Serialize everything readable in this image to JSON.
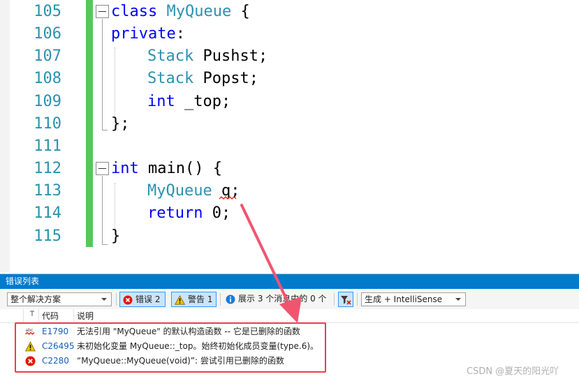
{
  "editor": {
    "line_numbers": [
      "105",
      "106",
      "107",
      "108",
      "109",
      "110",
      "111",
      "112",
      "113",
      "114",
      "115"
    ],
    "lines": {
      "l105": {
        "kw": "class",
        "name": "MyQueue",
        "brace": "{"
      },
      "l106": {
        "kw": "private",
        "colon": ":"
      },
      "l107": {
        "type": "Stack",
        "rest": "Pushst;"
      },
      "l108": {
        "type": "Stack",
        "rest": "Popst;"
      },
      "l109": {
        "kw": "int",
        "rest": "_top;"
      },
      "l110": {
        "text": "};"
      },
      "l112": {
        "kw": "int",
        "rest": "main()",
        "brace": "{"
      },
      "l113": {
        "type": "MyQueue",
        "var": "q",
        "semi": ";"
      },
      "l114": {
        "kw": "return",
        "rest": "0;"
      },
      "l115": {
        "text": "}"
      }
    },
    "colors": {
      "keyword": "#0000ff",
      "type": "#2b91af",
      "line_number": "#2b91af",
      "change_bar": "#57c757",
      "squiggle": "#e51400"
    }
  },
  "error_list": {
    "title": "错误列表",
    "scope": "整个解决方案",
    "errors_button": "错误 2",
    "warnings_button": "警告 1",
    "messages_button": "展示 3 个消息中的 0 个",
    "build_filter": "生成 + IntelliSense",
    "columns": {
      "code": "代码",
      "description": "说明"
    },
    "rows": [
      {
        "icon": "intellisense-error-icon",
        "code": "E1790",
        "description": "无法引用 \"MyQueue\" 的默认构造函数 -- 它是已删除的函数"
      },
      {
        "icon": "warning-icon",
        "code": "C26495",
        "description": "未初始化变量 MyQueue::_top。始终初始化成员变量(type.6)。"
      },
      {
        "icon": "error-icon",
        "code": "C2280",
        "description": "“MyQueue::MyQueue(void)”: 尝试引用已删除的函数"
      }
    ],
    "colors": {
      "title_bar": "#007acc",
      "highlight_box": "#e83e50",
      "arrow": "#f05570"
    }
  },
  "watermark": "CSDN @夏天的阳光吖"
}
